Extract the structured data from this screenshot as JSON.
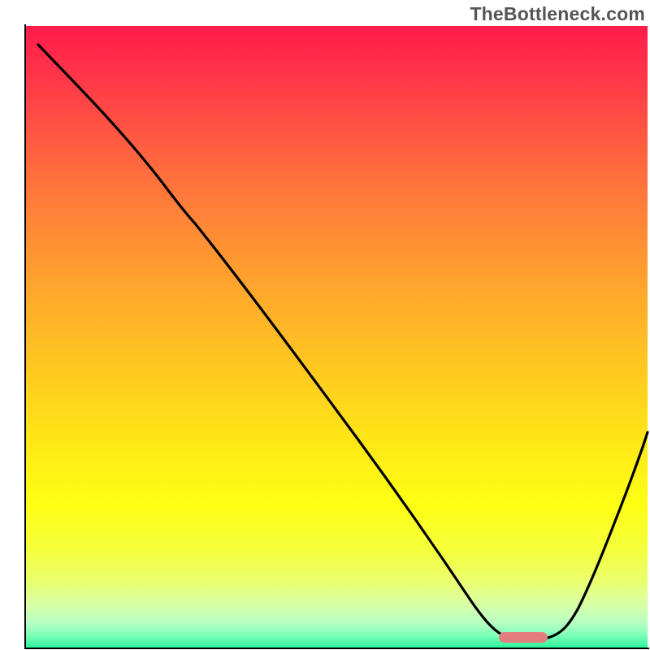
{
  "watermark": "TheBottleneck.com",
  "chart_data": {
    "type": "line",
    "title": "",
    "xlabel": "",
    "ylabel": "",
    "xlim": [
      0,
      100
    ],
    "ylim": [
      0,
      100
    ],
    "grid": false,
    "legend": false,
    "background_gradient": "red-to-green-vertical",
    "series": [
      {
        "name": "curve",
        "color": "#000000",
        "x": [
          2,
          6,
          12,
          18,
          22,
          27,
          33,
          40,
          48,
          55,
          62,
          68,
          72,
          75,
          78,
          82,
          86,
          90,
          94,
          100
        ],
        "y": [
          97,
          93,
          86,
          79,
          75,
          70,
          62,
          52,
          41,
          32,
          22,
          14,
          8,
          4,
          2,
          1,
          3,
          11,
          22,
          41
        ]
      }
    ],
    "marker": {
      "name": "optimal-range-marker",
      "color": "#e37e7e",
      "x_range": [
        76,
        83
      ],
      "y": 1.5,
      "shape": "rounded-rect"
    }
  }
}
